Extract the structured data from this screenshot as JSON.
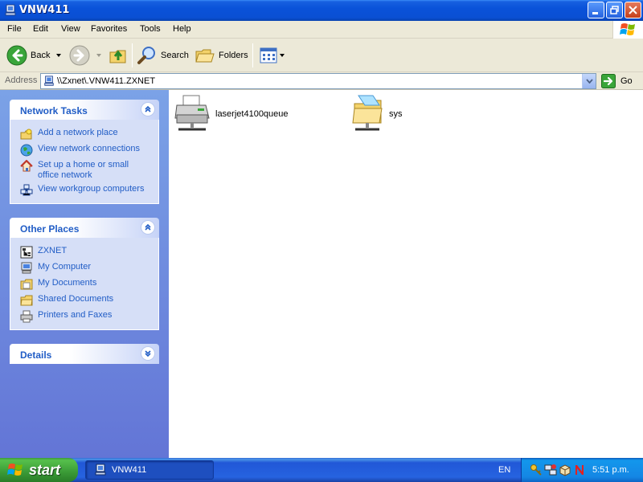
{
  "window": {
    "title": "VNW411"
  },
  "menu": {
    "items": [
      "File",
      "Edit",
      "View",
      "Favorites",
      "Tools",
      "Help"
    ]
  },
  "toolbar": {
    "back_label": "Back",
    "search_label": "Search",
    "folders_label": "Folders"
  },
  "address": {
    "label": "Address",
    "value": "\\\\Zxnet\\.VNW411.ZXNET",
    "go_label": "Go"
  },
  "panels": {
    "network_tasks": {
      "title": "Network Tasks",
      "items": [
        "Add a network place",
        "View network connections",
        "Set up a home or small office network",
        "View workgroup computers"
      ]
    },
    "other_places": {
      "title": "Other Places",
      "items": [
        "ZXNET",
        "My Computer",
        "My Documents",
        "Shared Documents",
        "Printers and Faxes"
      ]
    },
    "details": {
      "title": "Details"
    }
  },
  "content": {
    "items": [
      "laserjet4100queue",
      "sys"
    ]
  },
  "taskbar": {
    "start_label": "start",
    "task_label": "VNW411",
    "lang": "EN",
    "clock": "5:51 p.m."
  },
  "colors": {
    "title_blue": "#0a52d9",
    "link_blue": "#215dc6",
    "start_green": "#3a9a36"
  }
}
